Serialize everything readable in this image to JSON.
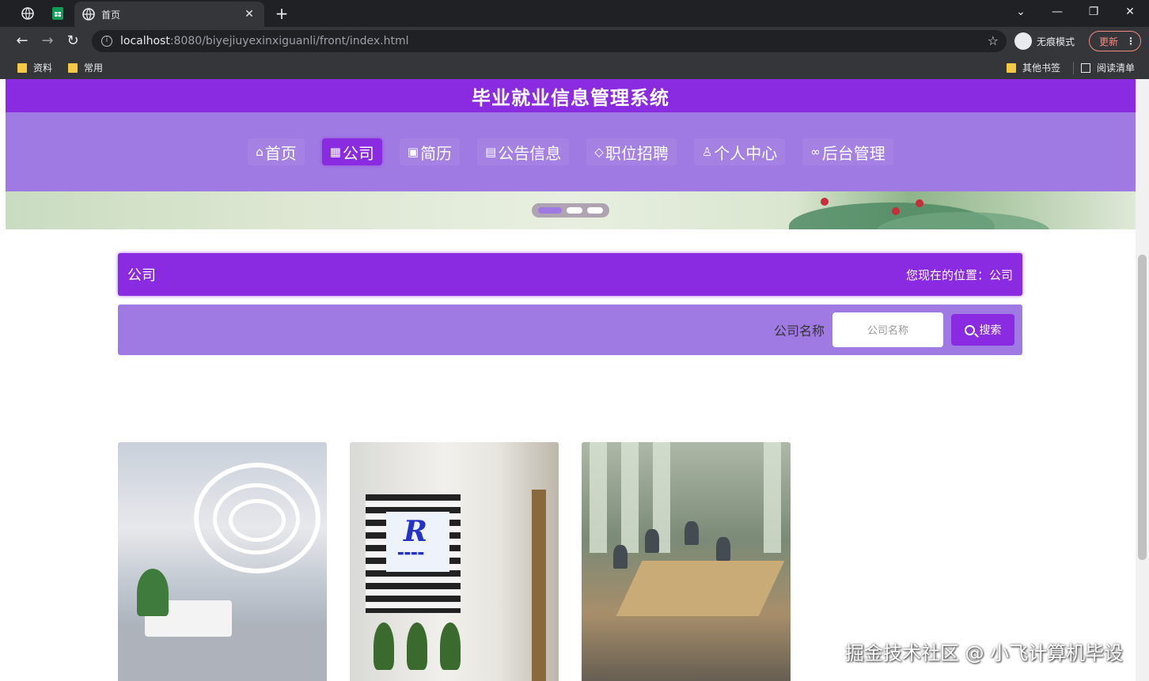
{
  "browser": {
    "tab_title": "首页",
    "url_host": "localhost",
    "url_path": ":8080/biyejiuyexinxiguanli/front/index.html",
    "incognito_label": "无痕模式",
    "update_label": "更新",
    "bookmarks": [
      "资料",
      "常用"
    ],
    "other_bookmarks": "其他书签",
    "reading_list": "阅读清单"
  },
  "site": {
    "title": "毕业就业信息管理系统",
    "nav": [
      {
        "icon": "⌂",
        "label": "首页"
      },
      {
        "icon": "▦",
        "label": "公司"
      },
      {
        "icon": "▣",
        "label": "简历"
      },
      {
        "icon": "▤",
        "label": "公告信息"
      },
      {
        "icon": "◇",
        "label": "职位招聘"
      },
      {
        "icon": "♙",
        "label": "个人中心"
      },
      {
        "icon": "∞",
        "label": "后台管理"
      }
    ],
    "active_nav": "公司"
  },
  "breadcrumb": {
    "title": "公司",
    "location": "您现在的位置：公司"
  },
  "search": {
    "label": "公司名称",
    "placeholder": "公司名称",
    "button": "搜索"
  },
  "card_count": 3,
  "watermark": "掘金技术社区 @ 小飞计算机毕设",
  "colors": {
    "primary": "#8a2be2",
    "nav_bg": "#a07ae3"
  }
}
